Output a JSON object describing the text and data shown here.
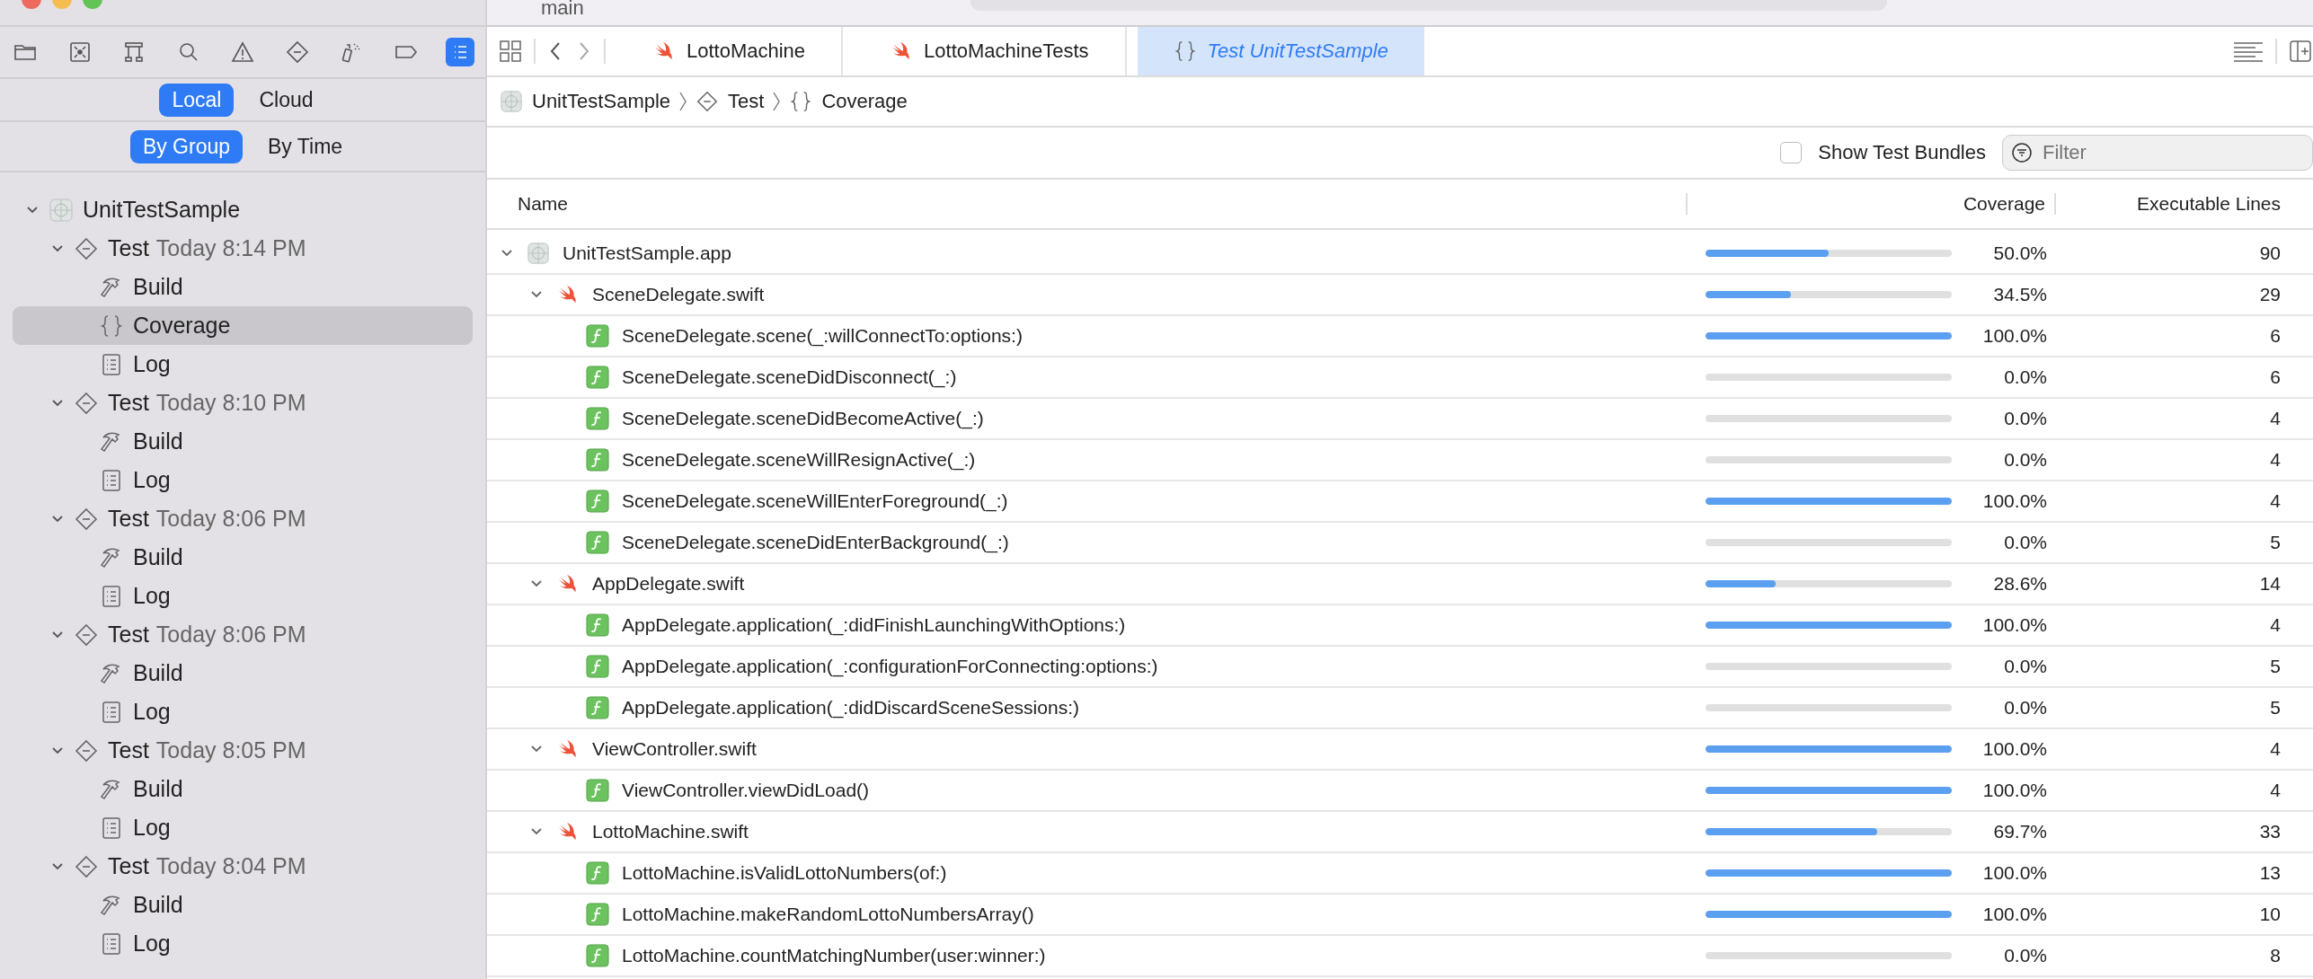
{
  "window": {
    "branch": "main"
  },
  "navigator_tabs": [
    {
      "kind": "folder",
      "selected": false
    },
    {
      "kind": "source-control",
      "selected": false
    },
    {
      "kind": "hierarchy",
      "selected": false
    },
    {
      "kind": "search",
      "selected": false
    },
    {
      "kind": "warning",
      "selected": false
    },
    {
      "kind": "test",
      "selected": false
    },
    {
      "kind": "debug",
      "selected": false
    },
    {
      "kind": "breakpoint",
      "selected": false
    },
    {
      "kind": "report",
      "selected": true
    }
  ],
  "source_segment": [
    {
      "label": "Local",
      "selected": true
    },
    {
      "label": "Cloud",
      "selected": false
    }
  ],
  "sort_segment": [
    {
      "label": "By Group",
      "selected": true
    },
    {
      "label": "By Time",
      "selected": false
    }
  ],
  "report_tree": {
    "kind": "project",
    "label": "UnitTestSample",
    "expanded": true,
    "selected": false,
    "children": [
      {
        "kind": "test",
        "label": "Test",
        "time": "Today 8:14 PM",
        "expanded": true,
        "selected": false,
        "children": [
          {
            "kind": "build",
            "label": "Build",
            "selected": false
          },
          {
            "kind": "coverage",
            "label": "Coverage",
            "selected": true
          },
          {
            "kind": "log",
            "label": "Log",
            "selected": false
          }
        ]
      },
      {
        "kind": "test",
        "label": "Test",
        "time": "Today 8:10 PM",
        "expanded": true,
        "selected": false,
        "children": [
          {
            "kind": "build",
            "label": "Build",
            "selected": false
          },
          {
            "kind": "log",
            "label": "Log",
            "selected": false
          }
        ]
      },
      {
        "kind": "test",
        "label": "Test",
        "time": "Today 8:06 PM",
        "expanded": true,
        "selected": false,
        "children": [
          {
            "kind": "build",
            "label": "Build",
            "selected": false
          },
          {
            "kind": "log",
            "label": "Log",
            "selected": false
          }
        ]
      },
      {
        "kind": "test",
        "label": "Test",
        "time": "Today 8:06 PM",
        "expanded": true,
        "selected": false,
        "children": [
          {
            "kind": "build",
            "label": "Build",
            "selected": false
          },
          {
            "kind": "log",
            "label": "Log",
            "selected": false
          }
        ]
      },
      {
        "kind": "test",
        "label": "Test",
        "time": "Today 8:05 PM",
        "expanded": true,
        "selected": false,
        "children": [
          {
            "kind": "build",
            "label": "Build",
            "selected": false
          },
          {
            "kind": "log",
            "label": "Log",
            "selected": false
          }
        ]
      },
      {
        "kind": "test",
        "label": "Test",
        "time": "Today 8:04 PM",
        "expanded": true,
        "selected": false,
        "children": [
          {
            "kind": "build",
            "label": "Build",
            "selected": false
          },
          {
            "kind": "log",
            "label": "Log",
            "selected": false
          }
        ]
      }
    ]
  },
  "editor_tabs": [
    {
      "kind": "swift",
      "label": "LottoMachine",
      "selected": false
    },
    {
      "kind": "swift",
      "label": "LottoMachineTests",
      "selected": false
    },
    {
      "kind": "report",
      "label": "Test UnitTestSample",
      "selected": true
    }
  ],
  "breadcrumb": [
    {
      "kind": "project",
      "label": "UnitTestSample"
    },
    {
      "kind": "test",
      "label": "Test"
    },
    {
      "kind": "coverage",
      "label": "Coverage"
    }
  ],
  "show_test_bundles": {
    "label": "Show Test Bundles",
    "checked": false
  },
  "filter": {
    "placeholder": "Filter"
  },
  "table": {
    "columns": [
      "Name",
      "Coverage",
      "Executable Lines"
    ],
    "rows": [
      {
        "kind": "target",
        "name": "UnitTestSample.app",
        "expanded": true,
        "level": 0.5,
        "coverage": "50.0%",
        "lines": "90",
        "children": [
          {
            "kind": "file",
            "name": "SceneDelegate.swift",
            "expanded": true,
            "level": 0.345,
            "coverage": "34.5%",
            "lines": "29",
            "children": [
              {
                "kind": "function",
                "name": "SceneDelegate.scene(_:willConnectTo:options:)",
                "level": 1,
                "coverage": "100.0%",
                "lines": "6"
              },
              {
                "kind": "function",
                "name": "SceneDelegate.sceneDidDisconnect(_:)",
                "level": 0,
                "coverage": "0.0%",
                "lines": "6"
              },
              {
                "kind": "function",
                "name": "SceneDelegate.sceneDidBecomeActive(_:)",
                "level": 0,
                "coverage": "0.0%",
                "lines": "4"
              },
              {
                "kind": "function",
                "name": "SceneDelegate.sceneWillResignActive(_:)",
                "level": 0,
                "coverage": "0.0%",
                "lines": "4"
              },
              {
                "kind": "function",
                "name": "SceneDelegate.sceneWillEnterForeground(_:)",
                "level": 1,
                "coverage": "100.0%",
                "lines": "4"
              },
              {
                "kind": "function",
                "name": "SceneDelegate.sceneDidEnterBackground(_:)",
                "level": 0,
                "coverage": "0.0%",
                "lines": "5"
              }
            ]
          },
          {
            "kind": "file",
            "name": "AppDelegate.swift",
            "expanded": true,
            "level": 0.286,
            "coverage": "28.6%",
            "lines": "14",
            "children": [
              {
                "kind": "function",
                "name": "AppDelegate.application(_:didFinishLaunchingWithOptions:)",
                "level": 1,
                "coverage": "100.0%",
                "lines": "4"
              },
              {
                "kind": "function",
                "name": "AppDelegate.application(_:configurationForConnecting:options:)",
                "level": 0,
                "coverage": "0.0%",
                "lines": "5"
              },
              {
                "kind": "function",
                "name": "AppDelegate.application(_:didDiscardSceneSessions:)",
                "level": 0,
                "coverage": "0.0%",
                "lines": "5"
              }
            ]
          },
          {
            "kind": "file",
            "name": "ViewController.swift",
            "expanded": true,
            "level": 1,
            "coverage": "100.0%",
            "lines": "4",
            "children": [
              {
                "kind": "function",
                "name": "ViewController.viewDidLoad()",
                "level": 1,
                "coverage": "100.0%",
                "lines": "4"
              }
            ]
          },
          {
            "kind": "file",
            "name": "LottoMachine.swift",
            "expanded": true,
            "level": 0.697,
            "coverage": "69.7%",
            "lines": "33",
            "children": [
              {
                "kind": "function",
                "name": "LottoMachine.isValidLottoNumbers(of:)",
                "level": 1,
                "coverage": "100.0%",
                "lines": "13"
              },
              {
                "kind": "function",
                "name": "LottoMachine.makeRandomLottoNumbersArray()",
                "level": 1,
                "coverage": "100.0%",
                "lines": "10"
              },
              {
                "kind": "function",
                "name": "LottoMachine.countMatchingNumber(user:winner:)",
                "level": 0,
                "coverage": "0.0%",
                "lines": "8"
              }
            ]
          }
        ]
      }
    ]
  }
}
